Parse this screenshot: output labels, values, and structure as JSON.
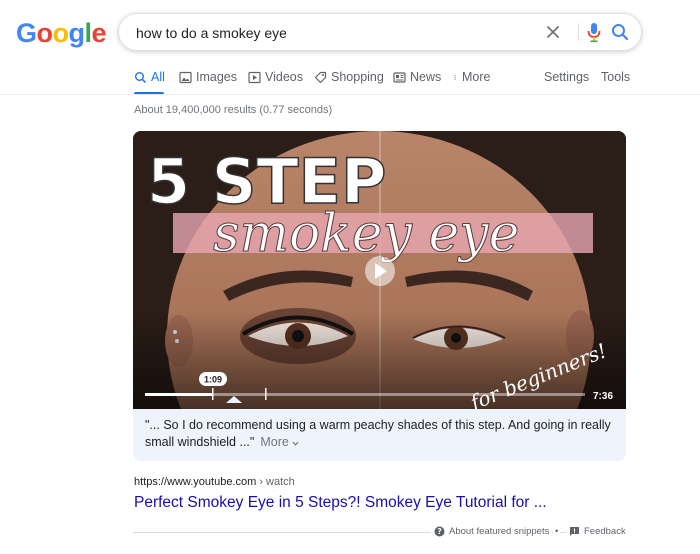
{
  "logo": {
    "letters": [
      "G",
      "o",
      "o",
      "g",
      "l",
      "e"
    ],
    "colors": [
      "#4285f4",
      "#ea4335",
      "#fbbc05",
      "#4285f4",
      "#34a853",
      "#ea4335"
    ]
  },
  "search": {
    "query": "how to do a smokey eye",
    "icons": [
      "close-icon",
      "mic-icon",
      "search-icon"
    ]
  },
  "tabs": [
    {
      "label": "All",
      "icon": "search-icon",
      "active": true
    },
    {
      "label": "Images",
      "icon": "image-icon"
    },
    {
      "label": "Videos",
      "icon": "play-icon"
    },
    {
      "label": "Shopping",
      "icon": "tag-icon"
    },
    {
      "label": "News",
      "icon": "news-icon"
    },
    {
      "label": "More",
      "icon": "dots-icon"
    }
  ],
  "tools": {
    "settings": "Settings",
    "tools": "Tools"
  },
  "result_stats": "About 19,400,000 results (0.77 seconds)",
  "video": {
    "overlay_title": "5 STEP",
    "overlay_script": "smokey eye",
    "overlay_tag": "for beginners!",
    "timestamp": "1:09",
    "duration": "7:36",
    "progress": 0.155
  },
  "snippet": {
    "text": "\"... So I do recommend using a warm peachy shades of this step. And going in really small windshield ...\"",
    "more_label": "More"
  },
  "result": {
    "url": "https://www.youtube.com",
    "crumb": " › watch",
    "title": "Perfect Smokey Eye in 5 Steps?! Smokey Eye Tutorial for ..."
  },
  "footer": {
    "about": "About featured snippets",
    "feedback": "Feedback",
    "separator": "•"
  }
}
